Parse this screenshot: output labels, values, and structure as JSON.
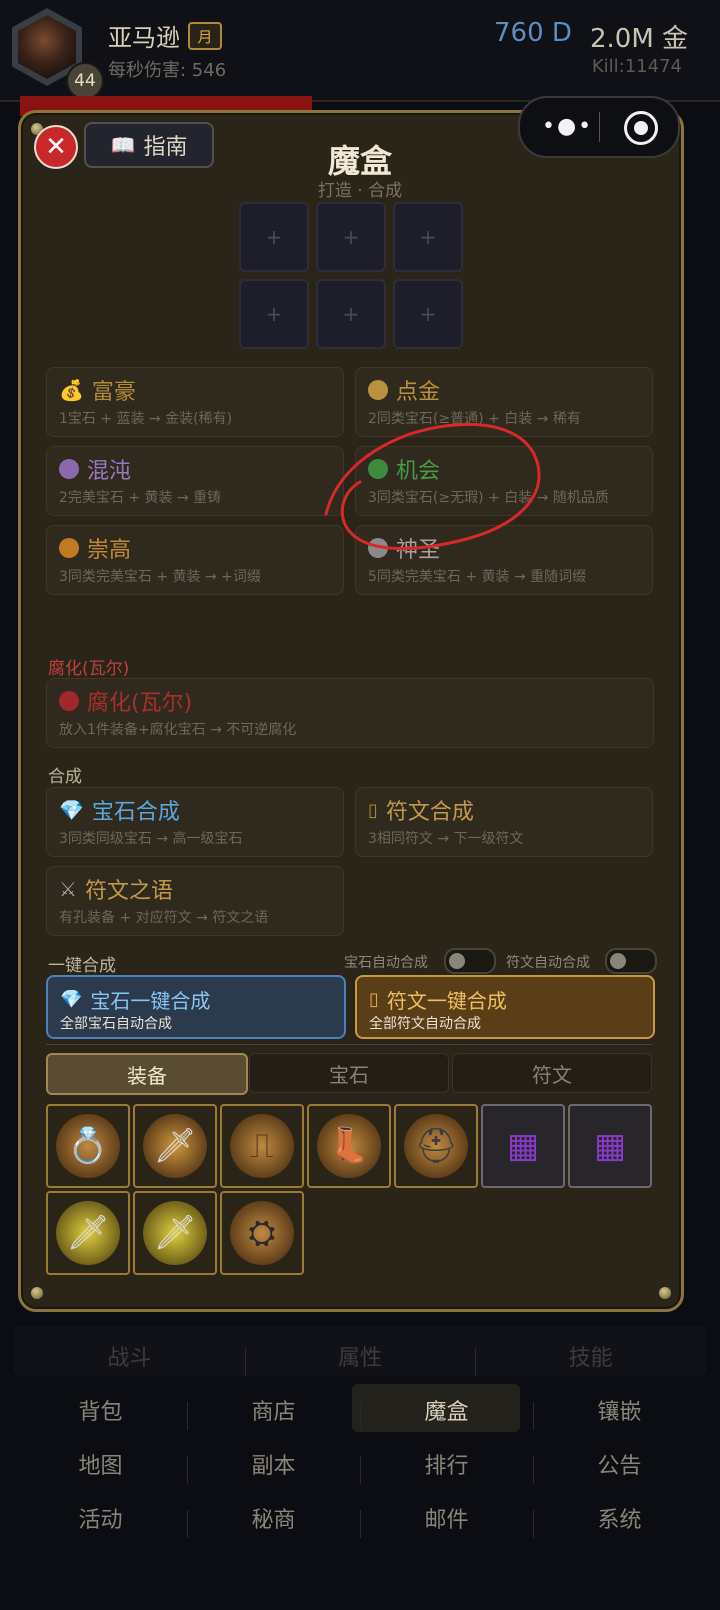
{
  "header": {
    "player_name": "亚马逊",
    "month_badge": "月",
    "level": "44",
    "dps": "每秒伤害: 546",
    "currency_d": "760 D",
    "currency_gold": "2.0M 金",
    "kill": "Kill:11474"
  },
  "modal": {
    "guide_label": "指南",
    "title": "魔盒",
    "subtitle": "打造 · 合成",
    "slot_plus": "+",
    "recipes": [
      {
        "title": "富豪",
        "desc": "1宝石 + 蓝装 → 金装(稀有)",
        "color": "#b08a3a",
        "icon": "money-bag-icon"
      },
      {
        "title": "点金",
        "desc": "2同类宝石(≥普通) + 白装 → 稀有",
        "color": "#b8923c"
      },
      {
        "title": "混沌",
        "desc": "2完美宝石 + 黄装 → 重铸",
        "color": "#8a6aaa"
      },
      {
        "title": "机会",
        "desc": "3同类宝石(≥无瑕) + 白装 → 随机品质",
        "color": "#3f8a3f"
      },
      {
        "title": "崇高",
        "desc": "3同类完美宝石 + 黄装 → +词缀",
        "color": "#c07a24"
      },
      {
        "title": "神圣",
        "desc": "5同类完美宝石 + 黄装 → 重随词缀",
        "color": "#8a8a8a"
      }
    ],
    "corrupt_section": "腐化(瓦尔)",
    "corrupt": {
      "title": "腐化(瓦尔)",
      "desc": "放入1件装备+腐化宝石 → 不可逆腐化",
      "color": "#a0282c"
    },
    "synth_section": "合成",
    "synth": [
      {
        "title": "宝石合成",
        "desc": "3同类同级宝石 → 高一级宝石",
        "icon": "gem-icon"
      },
      {
        "title": "符文合成",
        "desc": "3相同符文 → 下一级符文",
        "icon": "rune-icon"
      },
      {
        "title": "符文之语",
        "desc": "有孔装备 + 对应符文 → 符文之语",
        "icon": "crossed-swords-icon"
      }
    ],
    "oneclick_section": "一键合成",
    "toggle_gem_label": "宝石自动合成",
    "toggle_rune_label": "符文自动合成",
    "oneclick_gem": {
      "title": "宝石一键合成",
      "desc": "全部宝石自动合成"
    },
    "oneclick_rune": {
      "title": "符文一键合成",
      "desc": "全部符文自动合成"
    },
    "tabs": [
      "装备",
      "宝石",
      "符文"
    ],
    "active_tab": "装备",
    "inventory": [
      {
        "name": "ring-icon",
        "glyph": "💍"
      },
      {
        "name": "sword-icon",
        "glyph": "🗡"
      },
      {
        "name": "belt-icon",
        "glyph": "⎍"
      },
      {
        "name": "boots-icon",
        "glyph": "👢"
      },
      {
        "name": "helmet-icon",
        "glyph": "⛑"
      },
      {
        "name": "rune-card-icon",
        "glyph": "▦"
      },
      {
        "name": "rune-card-icon",
        "glyph": "▦"
      },
      {
        "name": "sword-icon",
        "glyph": "🗡"
      },
      {
        "name": "sword-icon",
        "glyph": "🗡"
      },
      {
        "name": "shield-icon",
        "glyph": "⛭"
      }
    ]
  },
  "bottom_nav": {
    "row1": [
      "战斗",
      "属性",
      "技能"
    ],
    "row2": [
      "背包",
      "商店",
      "魔盒",
      "镶嵌"
    ],
    "row3": [
      "地图",
      "副本",
      "排行",
      "公告"
    ],
    "row4": [
      "活动",
      "秘商",
      "邮件",
      "系统"
    ],
    "active": "魔盒"
  },
  "colors": {
    "accent_gold": "#d9a84a",
    "blue_d": "#5a8fc0",
    "annotation_red": "#d8282a"
  }
}
